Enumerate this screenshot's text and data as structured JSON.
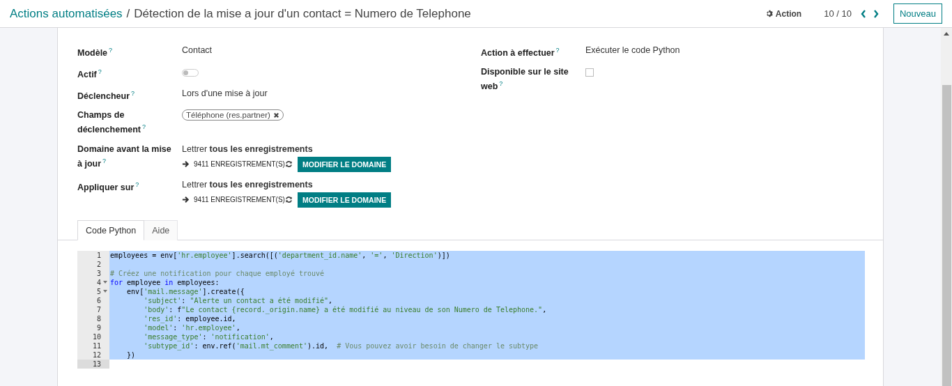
{
  "breadcrumb": {
    "parent": "Actions automatisées",
    "separator": "/",
    "current": "Détection de la mise a jour d'un contact = Numero de Telephone"
  },
  "control_panel": {
    "action_menu": "Action",
    "pager": "10 / 10",
    "new_button": "Nouveau"
  },
  "left_fields": [
    {
      "label": "Modèle",
      "help": "?",
      "kind": "text",
      "value": "Contact"
    },
    {
      "label": "Actif",
      "help": "?",
      "kind": "toggle",
      "on": false
    },
    {
      "label": "Déclencheur",
      "help": "?",
      "kind": "text",
      "value": "Lors d'une mise à jour"
    },
    {
      "label": "Champs de déclenchement",
      "help": "?",
      "kind": "tags",
      "tags": [
        "Téléphone (res.partner)"
      ]
    },
    {
      "label": "Domaine avant la mise à jour",
      "help": "?",
      "kind": "domain",
      "summary": "Lettrer **tous les enregistrements**",
      "count": "9411 ENREGISTREMENT(S)",
      "button": "MODIFIER LE DOMAINE"
    },
    {
      "label": "Appliquer sur",
      "help": "?",
      "kind": "domain",
      "summary": "Lettrer **tous les enregistrements**",
      "count": "9411 ENREGISTREMENT(S)",
      "button": "MODIFIER LE DOMAINE"
    }
  ],
  "right_fields": [
    {
      "label": "Action à effectuer",
      "help": "?",
      "kind": "text",
      "value": "Exécuter le code Python"
    },
    {
      "label": "Disponible sur le site web",
      "help": "?",
      "kind": "checkbox",
      "checked": false
    }
  ],
  "tabs": [
    {
      "label": "Code Python",
      "selected": true
    },
    {
      "label": "Aide",
      "selected": false
    }
  ],
  "code_lines": [
    {
      "number": "1",
      "fold": false,
      "selected": true,
      "current": false,
      "tokens": [
        {
          "kind": "plain",
          "text": "employees = env["
        },
        {
          "kind": "string",
          "text": "'hr.employee'"
        },
        {
          "kind": "plain",
          "text": "].search([("
        },
        {
          "kind": "string",
          "text": "'department_id.name'"
        },
        {
          "kind": "plain",
          "text": ", "
        },
        {
          "kind": "string",
          "text": "'='"
        },
        {
          "kind": "plain",
          "text": ", "
        },
        {
          "kind": "string",
          "text": "'Direction'"
        },
        {
          "kind": "plain",
          "text": ")])"
        }
      ]
    },
    {
      "number": "2",
      "fold": false,
      "selected": true,
      "current": false
    },
    {
      "number": "3",
      "fold": false,
      "selected": true,
      "current": false,
      "tokens": [
        {
          "kind": "comment",
          "text": "# Créez une notification pour chaque employé trouvé"
        }
      ]
    },
    {
      "number": "4",
      "fold": true,
      "selected": true,
      "current": false,
      "tokens": [
        {
          "kind": "keyword",
          "text": "for"
        },
        {
          "kind": "plain",
          "text": " employee "
        },
        {
          "kind": "keyword",
          "text": "in"
        },
        {
          "kind": "plain",
          "text": " employees:"
        }
      ]
    },
    {
      "number": "5",
      "fold": true,
      "selected": true,
      "current": false,
      "tokens": [
        {
          "kind": "plain",
          "text": "    env["
        },
        {
          "kind": "string",
          "text": "'mail.message'"
        },
        {
          "kind": "plain",
          "text": "].create({"
        }
      ]
    },
    {
      "number": "6",
      "fold": false,
      "selected": true,
      "current": false,
      "tokens": [
        {
          "kind": "string",
          "text": "        'subject'"
        },
        {
          "kind": "plain",
          "text": ": "
        },
        {
          "kind": "string",
          "text": "\"Alerte un contact a été modifié\""
        },
        {
          "kind": "plain",
          "text": ","
        }
      ]
    },
    {
      "number": "7",
      "fold": false,
      "selected": true,
      "current": false,
      "tokens": [
        {
          "kind": "string",
          "text": "        'body'"
        },
        {
          "kind": "plain",
          "text": ": f"
        },
        {
          "kind": "string",
          "text": "\"Le contact {record._origin.name} a été modifié au niveau de son Numero de Telephone.\""
        },
        {
          "kind": "plain",
          "text": ","
        }
      ]
    },
    {
      "number": "8",
      "fold": false,
      "selected": true,
      "current": false,
      "tokens": [
        {
          "kind": "string",
          "text": "        'res_id'"
        },
        {
          "kind": "plain",
          "text": ": employee.id,"
        }
      ]
    },
    {
      "number": "9",
      "fold": false,
      "selected": true,
      "current": false,
      "tokens": [
        {
          "kind": "string",
          "text": "        'model'"
        },
        {
          "kind": "plain",
          "text": ": "
        },
        {
          "kind": "string",
          "text": "'hr.employee'"
        },
        {
          "kind": "plain",
          "text": ","
        }
      ]
    },
    {
      "number": "10",
      "fold": false,
      "selected": true,
      "current": false,
      "tokens": [
        {
          "kind": "string",
          "text": "        'message_type'"
        },
        {
          "kind": "plain",
          "text": ": "
        },
        {
          "kind": "string",
          "text": "'notification'"
        },
        {
          "kind": "plain",
          "text": ","
        }
      ]
    },
    {
      "number": "11",
      "fold": false,
      "selected": true,
      "current": false,
      "tokens": [
        {
          "kind": "string",
          "text": "        'subtype_id'"
        },
        {
          "kind": "plain",
          "text": ": env.ref("
        },
        {
          "kind": "string",
          "text": "'mail.mt_comment'"
        },
        {
          "kind": "plain",
          "text": ").id,  "
        },
        {
          "kind": "comment",
          "text": "# Vous pouvez avoir besoin de changer le subtype"
        }
      ]
    },
    {
      "number": "12",
      "fold": false,
      "selected": true,
      "current": false,
      "tokens": [
        {
          "kind": "plain",
          "text": "    })"
        }
      ]
    },
    {
      "number": "13",
      "fold": false,
      "selected": false,
      "current": true
    }
  ]
}
